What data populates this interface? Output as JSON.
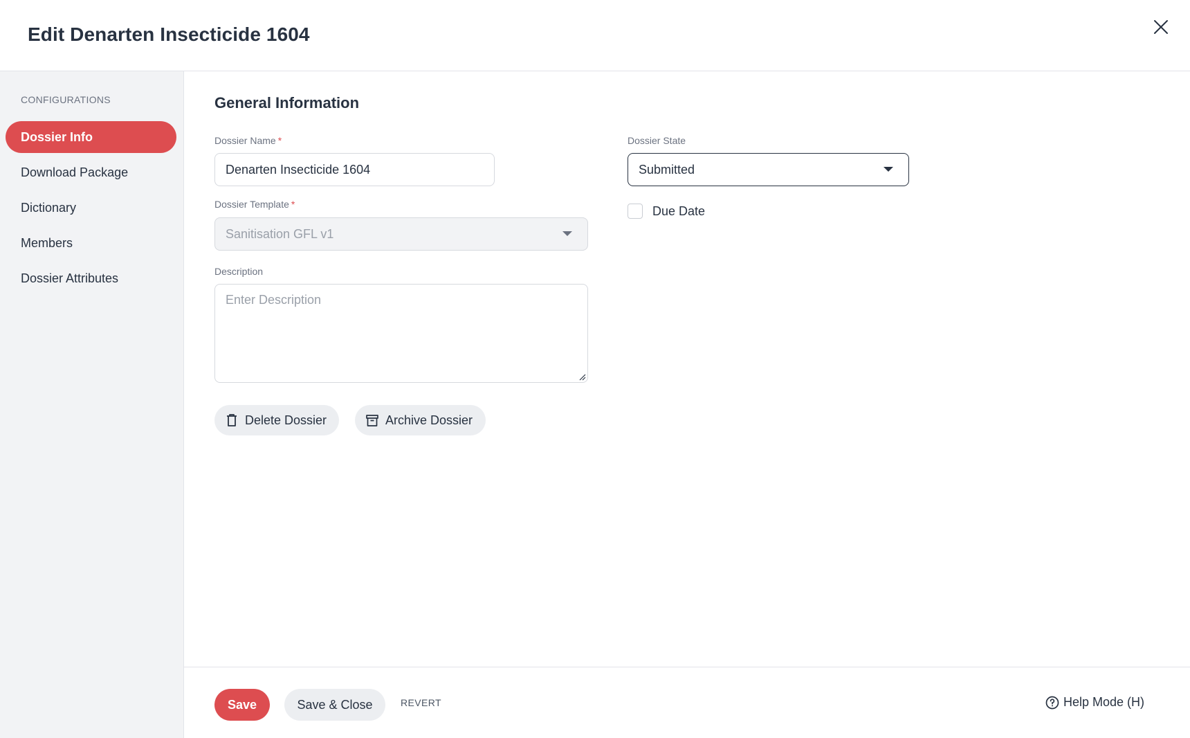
{
  "header": {
    "title": "Edit Denarten Insecticide 1604",
    "close_icon": "close-icon"
  },
  "sidebar": {
    "section_label": "CONFIGURATIONS",
    "items": [
      {
        "label": "Dossier Info",
        "active": true
      },
      {
        "label": "Download Package",
        "active": false
      },
      {
        "label": "Dictionary",
        "active": false
      },
      {
        "label": "Members",
        "active": false
      },
      {
        "label": "Dossier Attributes",
        "active": false
      }
    ]
  },
  "main": {
    "section_title": "General Information",
    "dossier_name": {
      "label": "Dossier Name",
      "required_mark": "*",
      "value": "Denarten Insecticide 1604"
    },
    "dossier_template": {
      "label": "Dossier Template",
      "required_mark": "*",
      "value": "Sanitisation GFL v1",
      "disabled": true
    },
    "description": {
      "label": "Description",
      "placeholder": "Enter Description",
      "value": ""
    },
    "dossier_state": {
      "label": "Dossier State",
      "value": "Submitted"
    },
    "due_date": {
      "label": "Due Date",
      "checked": false
    },
    "actions": {
      "delete_label": "Delete Dossier",
      "archive_label": "Archive Dossier"
    }
  },
  "footer": {
    "save_label": "Save",
    "save_close_label": "Save & Close",
    "revert_label": "REVERT",
    "help_label": "Help Mode (H)"
  },
  "colors": {
    "accent": "#dd4d50",
    "text": "#283241",
    "sidebar_bg": "#f2f3f5"
  }
}
